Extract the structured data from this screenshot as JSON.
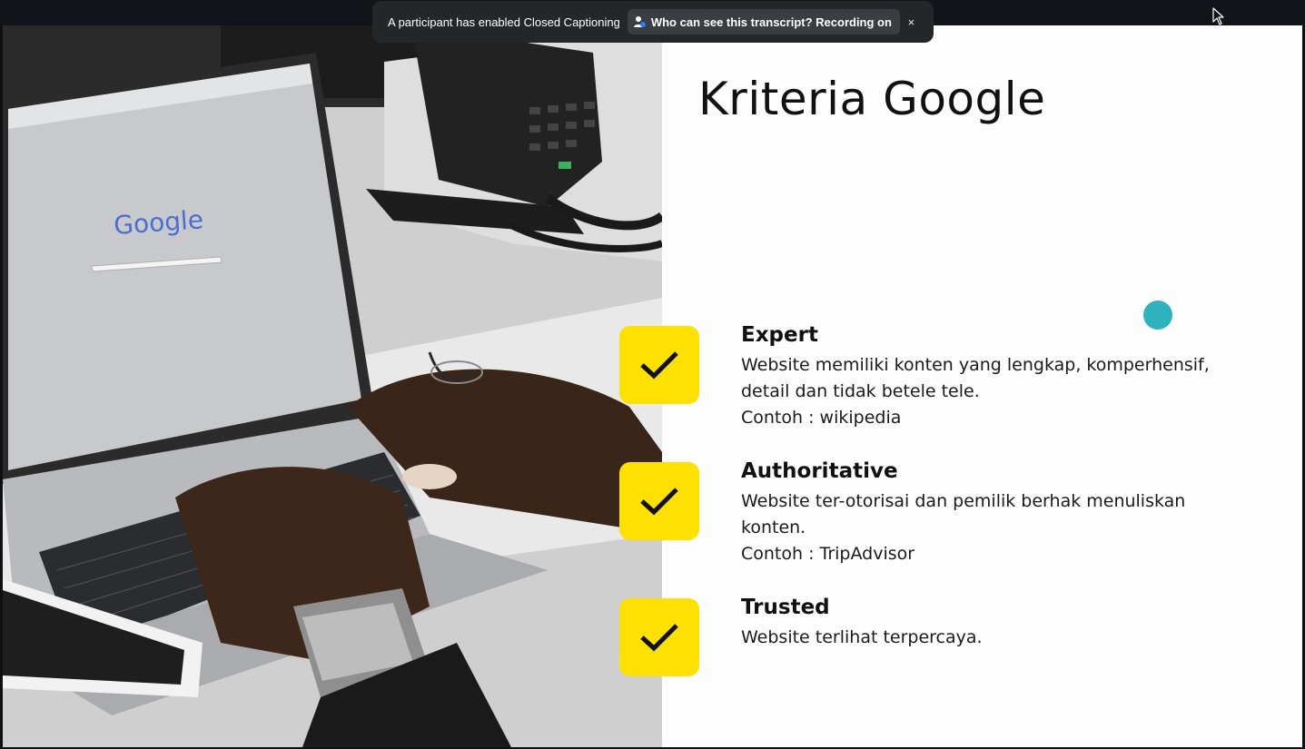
{
  "notification": {
    "message": "A participant has enabled Closed Captioning",
    "transcript_button": "Who can see this transcript? Recording on",
    "close_label": "×"
  },
  "slide": {
    "title": "Kriteria Google",
    "photo_google_logo": "Google",
    "items": [
      {
        "heading": "Expert",
        "description": "Website memiliki konten yang lengkap, komperhensif, detail dan tidak betele tele.",
        "example": "Contoh : wikipedia"
      },
      {
        "heading": "Authoritative",
        "description": "Website ter-otorisai dan pemilik berhak menuliskan konten.",
        "example": "Contoh : TripAdvisor"
      },
      {
        "heading": "Trusted",
        "description": "Website terlihat terpercaya."
      }
    ]
  },
  "colors": {
    "check_box": "#ffe000",
    "pointer_dot": "#2db3bd",
    "notification_bg": "#242629"
  },
  "icons": {
    "transcript": "person-info-icon",
    "check": "checkmark-icon",
    "close": "close-icon",
    "cursor": "mouse-cursor-icon"
  }
}
